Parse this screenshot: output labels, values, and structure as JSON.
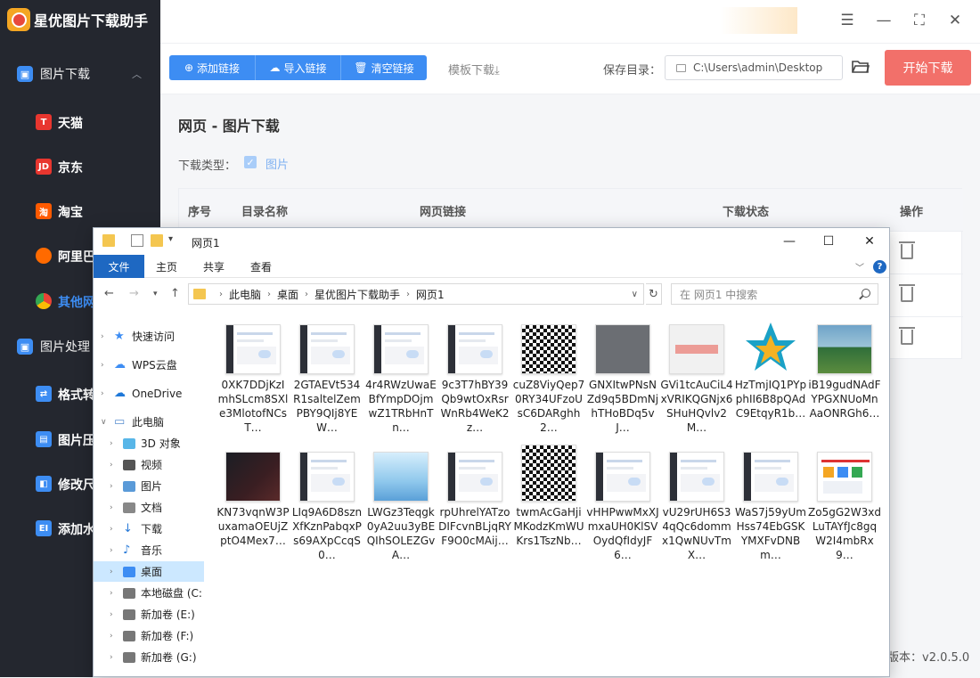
{
  "app": {
    "title": "星优图片下载助手",
    "version": "版本：v2.0.5.0"
  },
  "sidebar": {
    "sections": [
      {
        "label": "图片下载",
        "icon": "image-download-icon"
      },
      {
        "label": "图片处理",
        "icon": "image-process-icon"
      }
    ],
    "items": [
      {
        "label": "天猫",
        "icon_text": "T",
        "color": "#e8362f"
      },
      {
        "label": "京东",
        "icon_text": "JD",
        "color": "#e8362f"
      },
      {
        "label": "淘宝",
        "icon_text": "淘",
        "color": "#ff5a00"
      },
      {
        "label": "阿里巴",
        "icon_text": "",
        "color": "#ff6a00"
      },
      {
        "label": "其他网",
        "icon_text": "",
        "color": "#ffffff"
      },
      {
        "label": "格式转",
        "icon_text": "",
        "color": "#3d8df3"
      },
      {
        "label": "图片压",
        "icon_text": "",
        "color": "#3d8df3"
      },
      {
        "label": "修改尺",
        "icon_text": "",
        "color": "#3d8df3"
      },
      {
        "label": "添加水",
        "icon_text": "",
        "color": "#3d8df3"
      }
    ]
  },
  "toolbar": {
    "add_link": "添加链接",
    "import_link": "导入链接",
    "clear_link": "清空链接",
    "template_download": "模板下载⤓",
    "save_dir_label": "保存目录：",
    "save_dir_value": "C:\\Users\\admin\\Desktop",
    "start": "开始下载"
  },
  "main": {
    "title": "网页 - 图片下载",
    "download_type_label": "下载类型：",
    "download_type_value": "图片",
    "columns": [
      "序号",
      "目录名称",
      "网页链接",
      "下载状态",
      "操作"
    ]
  },
  "explorer": {
    "title": "网页1",
    "ribbon_tabs": [
      "文件",
      "主页",
      "共享",
      "查看"
    ],
    "breadcrumb": [
      "此电脑",
      "桌面",
      "星优图片下载助手",
      "网页1"
    ],
    "search_placeholder": "在 网页1 中搜索",
    "tree": [
      {
        "label": "快速访问",
        "icon": "quick-access-icon"
      },
      {
        "label": "WPS云盘",
        "icon": "cloud-icon"
      },
      {
        "label": "OneDrive",
        "icon": "onedrive-icon"
      },
      {
        "label": "此电脑",
        "icon": "computer-icon"
      },
      {
        "label": "3D 对象",
        "icon": "3d-objects-icon"
      },
      {
        "label": "视频",
        "icon": "video-icon"
      },
      {
        "label": "图片",
        "icon": "pictures-icon"
      },
      {
        "label": "文档",
        "icon": "documents-icon"
      },
      {
        "label": "下载",
        "icon": "downloads-icon"
      },
      {
        "label": "音乐",
        "icon": "music-icon"
      },
      {
        "label": "桌面",
        "icon": "desktop-icon"
      },
      {
        "label": "本地磁盘 (C:",
        "icon": "drive-icon"
      },
      {
        "label": "新加卷 (E:)",
        "icon": "drive-icon"
      },
      {
        "label": "新加卷 (F:)",
        "icon": "drive-icon"
      },
      {
        "label": "新加卷 (G:)",
        "icon": "drive-icon"
      }
    ],
    "files": [
      {
        "name": "0XK7DDjKzImhSLcm8SXle3MlotofNCsT…",
        "thumb": "screenshot"
      },
      {
        "name": "2GTAEVt534R1saltelZemPBY9QIj8YEW…",
        "thumb": "screenshot"
      },
      {
        "name": "4r4RWzUwaEBfYmpDOjmwZ1TRbHnTn…",
        "thumb": "screenshot"
      },
      {
        "name": "9c3T7hBY39Qb9wtOxRsrWnRb4WeK2z…",
        "thumb": "screenshot"
      },
      {
        "name": "cuZ8ViyQep70RY34UFzoUsC6DARghh2…",
        "thumb": "qrcode"
      },
      {
        "name": "GNXItwPNsNZd9q5BDmNjhTHoBDq5vJ…",
        "thumb": "gray"
      },
      {
        "name": "GVi1tcAuCiL4xVRIKQGNjx6SHuHQvlv2M…",
        "thumb": "heic"
      },
      {
        "name": "HzTmjIQ1PYpphII6B8pQAdC9EtqyR1b…",
        "thumb": "star"
      },
      {
        "name": "iB19gudNAdFYPGXNUoMnAaONRGh6…",
        "thumb": "photo"
      },
      {
        "name": "KN73vqnW3PuxamaOEUjZptO4Mex7…",
        "thumb": "dark"
      },
      {
        "name": "LIq9A6D8sznXfKznPabqxPs69AXpCcqS0…",
        "thumb": "screenshot"
      },
      {
        "name": "LWGz3Teqgk0yA2uu3yBEQIhSOLEZGvA…",
        "thumb": "sky"
      },
      {
        "name": "rpUhrelYATzoDIFcvnBLjqRYF9O0cMAij…",
        "thumb": "screenshot"
      },
      {
        "name": "twmAcGaHjiMKodzKmWUKrs1TszNb…",
        "thumb": "qrcode2"
      },
      {
        "name": "vHHPwwMxXJmxaUH0KlSVOydQfIdyJF6…",
        "thumb": "screenshot"
      },
      {
        "name": "vU29rUH6S34qQc6dommx1QwNUvTmX…",
        "thumb": "screenshot"
      },
      {
        "name": "WaS7j59yUmHss74EbGSKYMXFvDNBm…",
        "thumb": "screenshot"
      },
      {
        "name": "Zo5gG2W3xdLuTAYfJc8gqW2I4mbRx9…",
        "thumb": "colorful"
      }
    ]
  }
}
